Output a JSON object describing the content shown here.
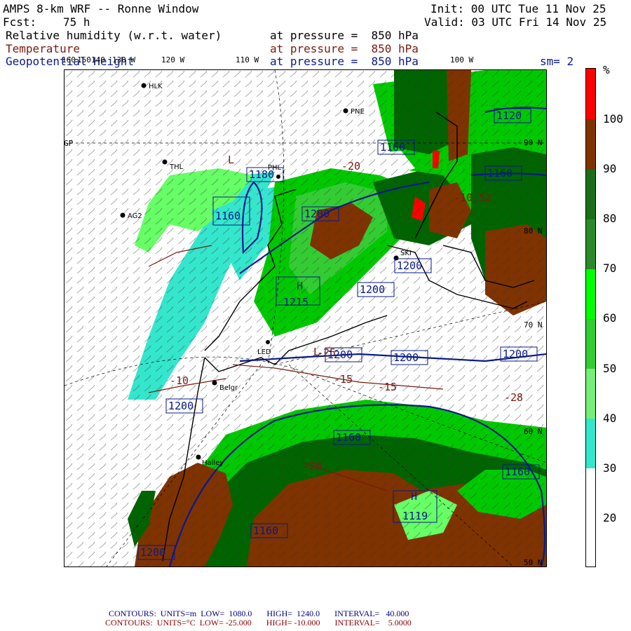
{
  "header": {
    "title": "AMPS 8-km WRF -- Ronne Window",
    "init": "Init: 00 UTC Tue 11 Nov 25",
    "fcst_label": "Fcst:",
    "fcst_value": "75 h",
    "valid": "Valid: 03 UTC Fri 14 Nov 25",
    "field1": "Relative humidity (w.r.t. water)",
    "field1_level": "at pressure =  850 hPa",
    "field2": "Temperature",
    "field2_level": "at pressure =  850 hPa",
    "field3": "Geopotential Height",
    "field3_level": "at pressure =  850 hPa",
    "smoothing": "sm= 2"
  },
  "map": {
    "lon_labels": [
      "160",
      "150",
      "140",
      "130 W",
      "120 W",
      "110 W",
      "100 W"
    ],
    "lat_labels": [
      "90 N",
      "80 N",
      "70 N",
      "60 N",
      "50 N"
    ],
    "gp_label": "GP",
    "stations": [
      "HLK",
      "PNE",
      "THL",
      "PHL",
      "AG2",
      "SKI",
      "LED",
      "Belgr",
      "Halley"
    ],
    "height_contour_labels": [
      "1120",
      "1160",
      "1160",
      "1180",
      "1200",
      "1200",
      "1200",
      "1200",
      "1200",
      "1200",
      "1200",
      "1200",
      "1160",
      "1160",
      "1160",
      "1160",
      "1200",
      "1215",
      "1119"
    ],
    "temp_contour_labels": [
      "-15",
      "-15",
      "-10",
      "-20",
      "-25",
      "-28",
      "-20",
      "-10.52"
    ],
    "extremum_labels": [
      "H",
      "H",
      "L",
      "L"
    ]
  },
  "colorbar": {
    "unit": "%",
    "labels": [
      "100",
      "90",
      "80",
      "70",
      "60",
      "50",
      "40",
      "30",
      "20"
    ],
    "colors": [
      "#ff0000",
      "#7f3300",
      "#006400",
      "#228b22",
      "#00ff00",
      "#33cc33",
      "#66ff66",
      "#33e6cc",
      "#ffffff"
    ]
  },
  "footer": {
    "line1": "CONTOURS:  UNITS=m  LOW=  1080.0       HIGH=  1240.0       INTERVAL=   40.000",
    "line2": "CONTOURS:  UNITS=°C  LOW= -25.000       HIGH= -10.000       INTERVAL=    5.0000",
    "line1_color": "#000080",
    "line2_color": "#8b0000"
  }
}
